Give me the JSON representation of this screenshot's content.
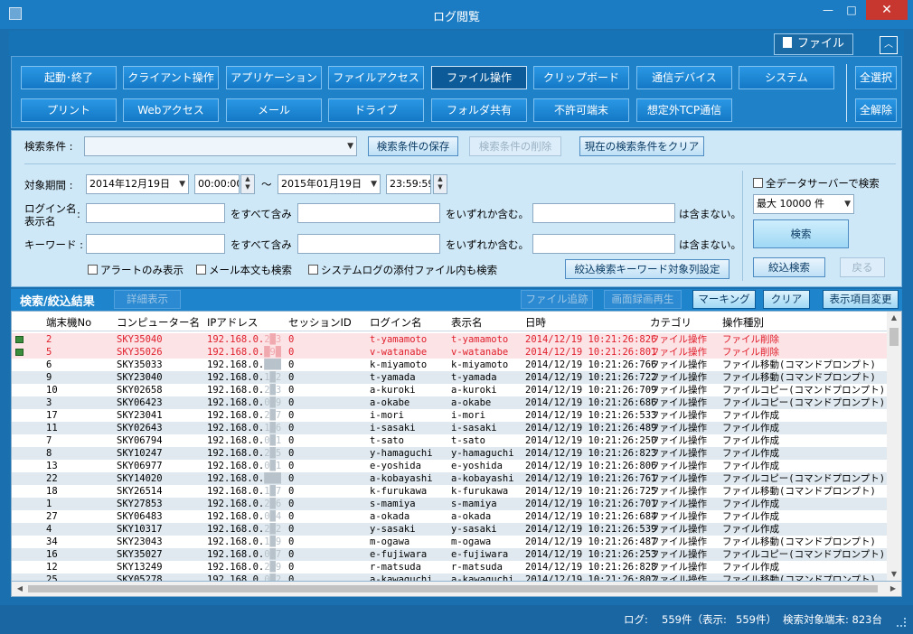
{
  "window": {
    "title": "ログ閲覧",
    "min": "—",
    "max": "□",
    "close": "✕"
  },
  "ribbon": {
    "file_label": "ファイル",
    "collapse": "︿"
  },
  "colors": {
    "title_bar": "#1b7cc3",
    "category_bg": "#1f81c8",
    "panel_bg": "#cfe8f8",
    "alert_row_bg": "#fbe3e6",
    "alert_text": "#e0202c",
    "alt_row_bg": "#dfe9ef"
  },
  "categories_row1": [
    "起動･終了",
    "クライアント操作",
    "アプリケーション",
    "ファイルアクセス",
    "ファイル操作",
    "クリップボード",
    "通信デバイス",
    "システム"
  ],
  "categories_row2": [
    "プリント",
    "Webアクセス",
    "メール",
    "ドライブ",
    "フォルダ共有",
    "不許可端末",
    "想定外TCP通信"
  ],
  "active_category": "ファイル操作",
  "select_all": "全選択",
  "clear_all": "全解除",
  "search": {
    "condition_label": "検索条件 :",
    "condition_value": "",
    "save_condition": "検索条件の保存",
    "delete_condition": "検索条件の削除",
    "clear_condition": "現在の検索条件をクリア",
    "period_label": "対象期間 :",
    "from_date": "2014年12月19日",
    "from_time": "00:00:00",
    "tilde": "～",
    "to_date": "2015年01月19日",
    "to_time": "23:59:59",
    "login_label_1": "ログイン名",
    "login_label_2": "表示名",
    "colon": ":",
    "keyword_label": "キーワード :",
    "contains_all": "をすべて含み",
    "contains_any": "をいずれか含む。",
    "not_contains": "は含まない。",
    "login_all": "",
    "login_any": "",
    "login_not": "",
    "keyword_all": "",
    "keyword_any": "",
    "keyword_not": "",
    "alert_only": "アラートのみ表示",
    "mail_body": "メール本文も検索",
    "attachment": "システムログの添付ファイル内も検索",
    "refine_setting": "絞込検索キーワード対象列設定",
    "all_servers": "全データサーバーで検索",
    "max_count": "最大 10000 件",
    "search_button": "検索",
    "refine_button": "絞込検索",
    "back_button": "戻る"
  },
  "results": {
    "title": "検索/絞込結果",
    "detail": "詳細表示",
    "file_trace": "ファイル追跡",
    "screen_replay": "画面録画再生",
    "marking": "マーキング",
    "clear": "クリア",
    "change_columns": "表示項目変更"
  },
  "table": {
    "headers": [
      "端末機No",
      "コンピューター名",
      "IPアドレス",
      "セッションID",
      "ログイン名",
      "表示名",
      "日時",
      "カテゴリ",
      "操作種別"
    ],
    "ip_prefix": "192.168.0.",
    "rows": [
      {
        "no": "2",
        "pc": "SKY35040",
        "ip_tail": "2█3",
        "session": "0",
        "login": "t-yamamoto",
        "display": "t-yamamoto",
        "date": "2014/12/19 10:21:26:826",
        "category": "ファイル操作",
        "op": "ファイル削除",
        "alert": true
      },
      {
        "no": "5",
        "pc": "SKY35026",
        "ip_tail": "█9█",
        "session": "0",
        "login": "v-watanabe",
        "display": "v-watanabe",
        "date": "2014/12/19 10:21:26:801",
        "category": "ファイル操作",
        "op": "ファイル削除",
        "alert": true
      },
      {
        "no": "6",
        "pc": "SKY35033",
        "ip_tail": "███",
        "session": "0",
        "login": "k-miyamoto",
        "display": "k-miyamoto",
        "date": "2014/12/19 10:21:26:766",
        "category": "ファイル操作",
        "op": "ファイル移動(コマンドプロンプト)"
      },
      {
        "no": "9",
        "pc": "SKY23040",
        "ip_tail": "1█2",
        "session": "0",
        "login": "t-yamada",
        "display": "t-yamada",
        "date": "2014/12/19 10:21:26:722",
        "category": "ファイル操作",
        "op": "ファイル移動(コマンドプロンプト)"
      },
      {
        "no": "10",
        "pc": "SKY02658",
        "ip_tail": "2█3",
        "session": "0",
        "login": "a-kuroki",
        "display": "a-kuroki",
        "date": "2014/12/19 10:21:26:709",
        "category": "ファイル操作",
        "op": "ファイルコピー(コマンドプロンプト)"
      },
      {
        "no": "3",
        "pc": "SKY06423",
        "ip_tail": "0█9",
        "session": "0",
        "login": "a-okabe",
        "display": "a-okabe",
        "date": "2014/12/19 10:21:26:686",
        "category": "ファイル操作",
        "op": "ファイルコピー(コマンドプロンプト)"
      },
      {
        "no": "17",
        "pc": "SKY23041",
        "ip_tail": "2█7",
        "session": "0",
        "login": "i-mori",
        "display": "i-mori",
        "date": "2014/12/19 10:21:26:533",
        "category": "ファイル操作",
        "op": "ファイル作成"
      },
      {
        "no": "11",
        "pc": "SKY02643",
        "ip_tail": "1█6",
        "session": "0",
        "login": "i-sasaki",
        "display": "i-sasaki",
        "date": "2014/12/19 10:21:26:489",
        "category": "ファイル操作",
        "op": "ファイル作成"
      },
      {
        "no": "7",
        "pc": "SKY06794",
        "ip_tail": "0█1",
        "session": "0",
        "login": "t-sato",
        "display": "t-sato",
        "date": "2014/12/19 10:21:26:250",
        "category": "ファイル操作",
        "op": "ファイル作成"
      },
      {
        "no": "8",
        "pc": "SKY10247",
        "ip_tail": "2█5",
        "session": "0",
        "login": "y-hamaguchi",
        "display": "y-hamaguchi",
        "date": "2014/12/19 10:21:26:823",
        "category": "ファイル操作",
        "op": "ファイル作成"
      },
      {
        "no": "13",
        "pc": "SKY06977",
        "ip_tail": "0█1",
        "session": "0",
        "login": "e-yoshida",
        "display": "e-yoshida",
        "date": "2014/12/19 10:21:26:806",
        "category": "ファイル操作",
        "op": "ファイル作成"
      },
      {
        "no": "22",
        "pc": "SKY14020",
        "ip_tail": "███",
        "session": "0",
        "login": "a-kobayashi",
        "display": "a-kobayashi",
        "date": "2014/12/19 10:21:26:761",
        "category": "ファイル操作",
        "op": "ファイルコピー(コマンドプロンプト)"
      },
      {
        "no": "18",
        "pc": "SKY26514",
        "ip_tail": "1█7",
        "session": "0",
        "login": "k-furukawa",
        "display": "k-furukawa",
        "date": "2014/12/19 10:21:26:725",
        "category": "ファイル操作",
        "op": "ファイル移動(コマンドプロンプト)"
      },
      {
        "no": "1",
        "pc": "SKY27853",
        "ip_tail": "2█6",
        "session": "0",
        "login": "s-mamiya",
        "display": "s-mamiya",
        "date": "2014/12/19 10:21:26:701",
        "category": "ファイル操作",
        "op": "ファイル作成"
      },
      {
        "no": "27",
        "pc": "SKY06483",
        "ip_tail": "0█4",
        "session": "0",
        "login": "a-okada",
        "display": "a-okada",
        "date": "2014/12/19 10:21:26:684",
        "category": "ファイル操作",
        "op": "ファイル作成"
      },
      {
        "no": "4",
        "pc": "SKY10317",
        "ip_tail": "2█2",
        "session": "0",
        "login": "y-sasaki",
        "display": "y-sasaki",
        "date": "2014/12/19 10:21:26:539",
        "category": "ファイル操作",
        "op": "ファイル作成"
      },
      {
        "no": "34",
        "pc": "SKY23043",
        "ip_tail": "1█9",
        "session": "0",
        "login": "m-ogawa",
        "display": "m-ogawa",
        "date": "2014/12/19 10:21:26:487",
        "category": "ファイル操作",
        "op": "ファイル移動(コマンドプロンプト)"
      },
      {
        "no": "16",
        "pc": "SKY35027",
        "ip_tail": "0█7",
        "session": "0",
        "login": "e-fujiwara",
        "display": "e-fujiwara",
        "date": "2014/12/19 10:21:26:253",
        "category": "ファイル操作",
        "op": "ファイルコピー(コマンドプロンプト)"
      },
      {
        "no": "12",
        "pc": "SKY13249",
        "ip_tail": "2█9",
        "session": "0",
        "login": "r-matsuda",
        "display": "r-matsuda",
        "date": "2014/12/19 10:21:26:828",
        "category": "ファイル操作",
        "op": "ファイル作成"
      },
      {
        "no": "25",
        "pc": "SKY05278",
        "ip_tail": "0█2",
        "session": "0",
        "login": "a-kawaguchi",
        "display": "a-kawaguchi",
        "date": "2014/12/19 10:21:26:802",
        "category": "ファイル操作",
        "op": "ファイル移動(コマンドプロンプト)"
      }
    ]
  },
  "status": {
    "log_label": "ログ:",
    "log_count": "559件（表示:",
    "shown_count": "559件）",
    "terminals": "検索対象端末: 823台"
  }
}
